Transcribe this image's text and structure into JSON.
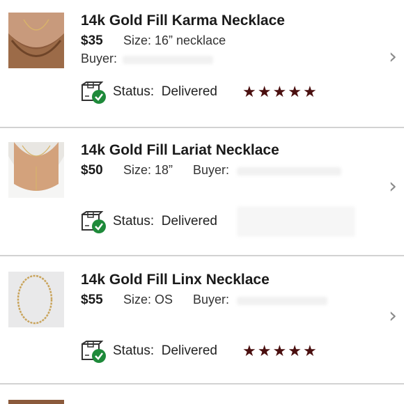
{
  "colors": {
    "star": "#4a0f0f",
    "check": "#1e8a3a",
    "divider": "#d2d2d2"
  },
  "orders": [
    {
      "title": "14k Gold Fill Karma Necklace",
      "price": "$35",
      "size": "Size: 16” necklace",
      "buyer_label": "Buyer:",
      "status_label": "Status:",
      "status_value": "Delivered",
      "rating": 5
    },
    {
      "title": "14k Gold Fill Lariat Necklace",
      "price": "$50",
      "size": "Size: 18”",
      "buyer_label": "Buyer:",
      "status_label": "Status:",
      "status_value": "Delivered",
      "rating": 0
    },
    {
      "title": "14k Gold Fill Linx Necklace",
      "price": "$55",
      "size": "Size: OS",
      "buyer_label": "Buyer:",
      "status_label": "Status:",
      "status_value": "Delivered",
      "rating": 5
    }
  ],
  "icons": {
    "status": "package-check-icon",
    "chevron": "chevron-right-icon",
    "star": "star-icon"
  }
}
